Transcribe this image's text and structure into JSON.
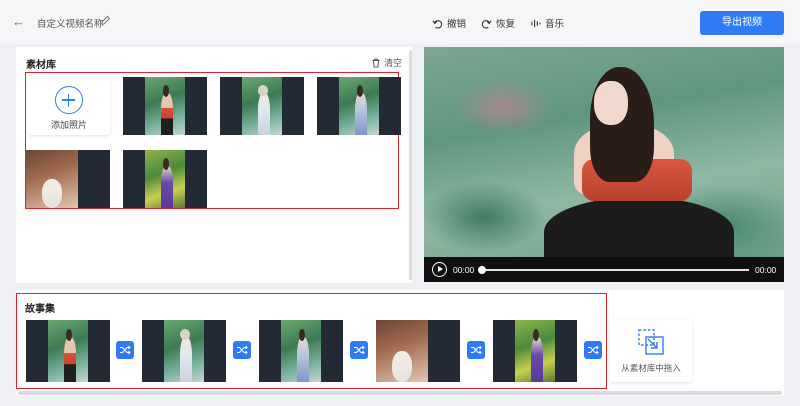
{
  "header": {
    "title": "自定义视频名称",
    "undo_label": "撤销",
    "redo_label": "恢复",
    "music_label": "音乐",
    "export_label": "导出视频"
  },
  "library": {
    "title": "素材库",
    "clear_label": "清空",
    "add_label": "添加照片"
  },
  "player": {
    "current_time": "00:00",
    "duration": "00:00",
    "progress": 0
  },
  "story": {
    "title": "故事集",
    "drag_label": "从素材库中拖入"
  },
  "colors": {
    "accent": "#2f7bf5",
    "highlight_border": "#d9262c"
  }
}
